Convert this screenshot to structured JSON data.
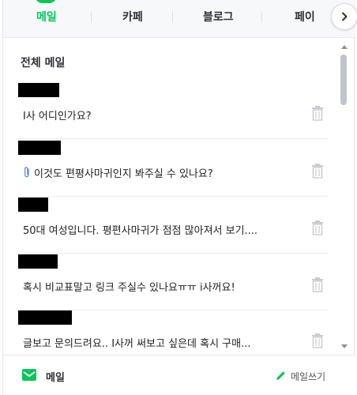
{
  "tabs": {
    "items": [
      {
        "label": "메일",
        "active": true
      },
      {
        "label": "카페",
        "active": false
      },
      {
        "label": "블로그",
        "active": false
      },
      {
        "label": "페이",
        "active": false
      }
    ],
    "next_icon": "chevron-right-icon"
  },
  "section": {
    "title": "전체 메일"
  },
  "mails": [
    {
      "sender": "[redacted]",
      "subject": "I사 어디인가요?",
      "has_attachment": false
    },
    {
      "sender": "[redacted]",
      "subject": "이것도 편평사마귀인지 봐주실 수 있나요?",
      "has_attachment": true
    },
    {
      "sender": "[redacted]",
      "subject": "50대 여성입니다. 평편사마귀가 점점 많아져서 보기....",
      "has_attachment": false
    },
    {
      "sender": "[redacted]",
      "subject": "혹시 비교표말고 링크 주실수 있나요ㅠㅠ i사꺼요!",
      "has_attachment": false
    },
    {
      "sender": "[redacted]",
      "subject": "글보고 문의드려요.. I사꺼 써보고 싶은데 혹시 구매...",
      "has_attachment": false
    }
  ],
  "footer": {
    "mail_label": "메일",
    "write_label": "메일쓰기"
  },
  "colors": {
    "accent": "#03c75a",
    "text": "#303038",
    "redaction": "#000000"
  }
}
